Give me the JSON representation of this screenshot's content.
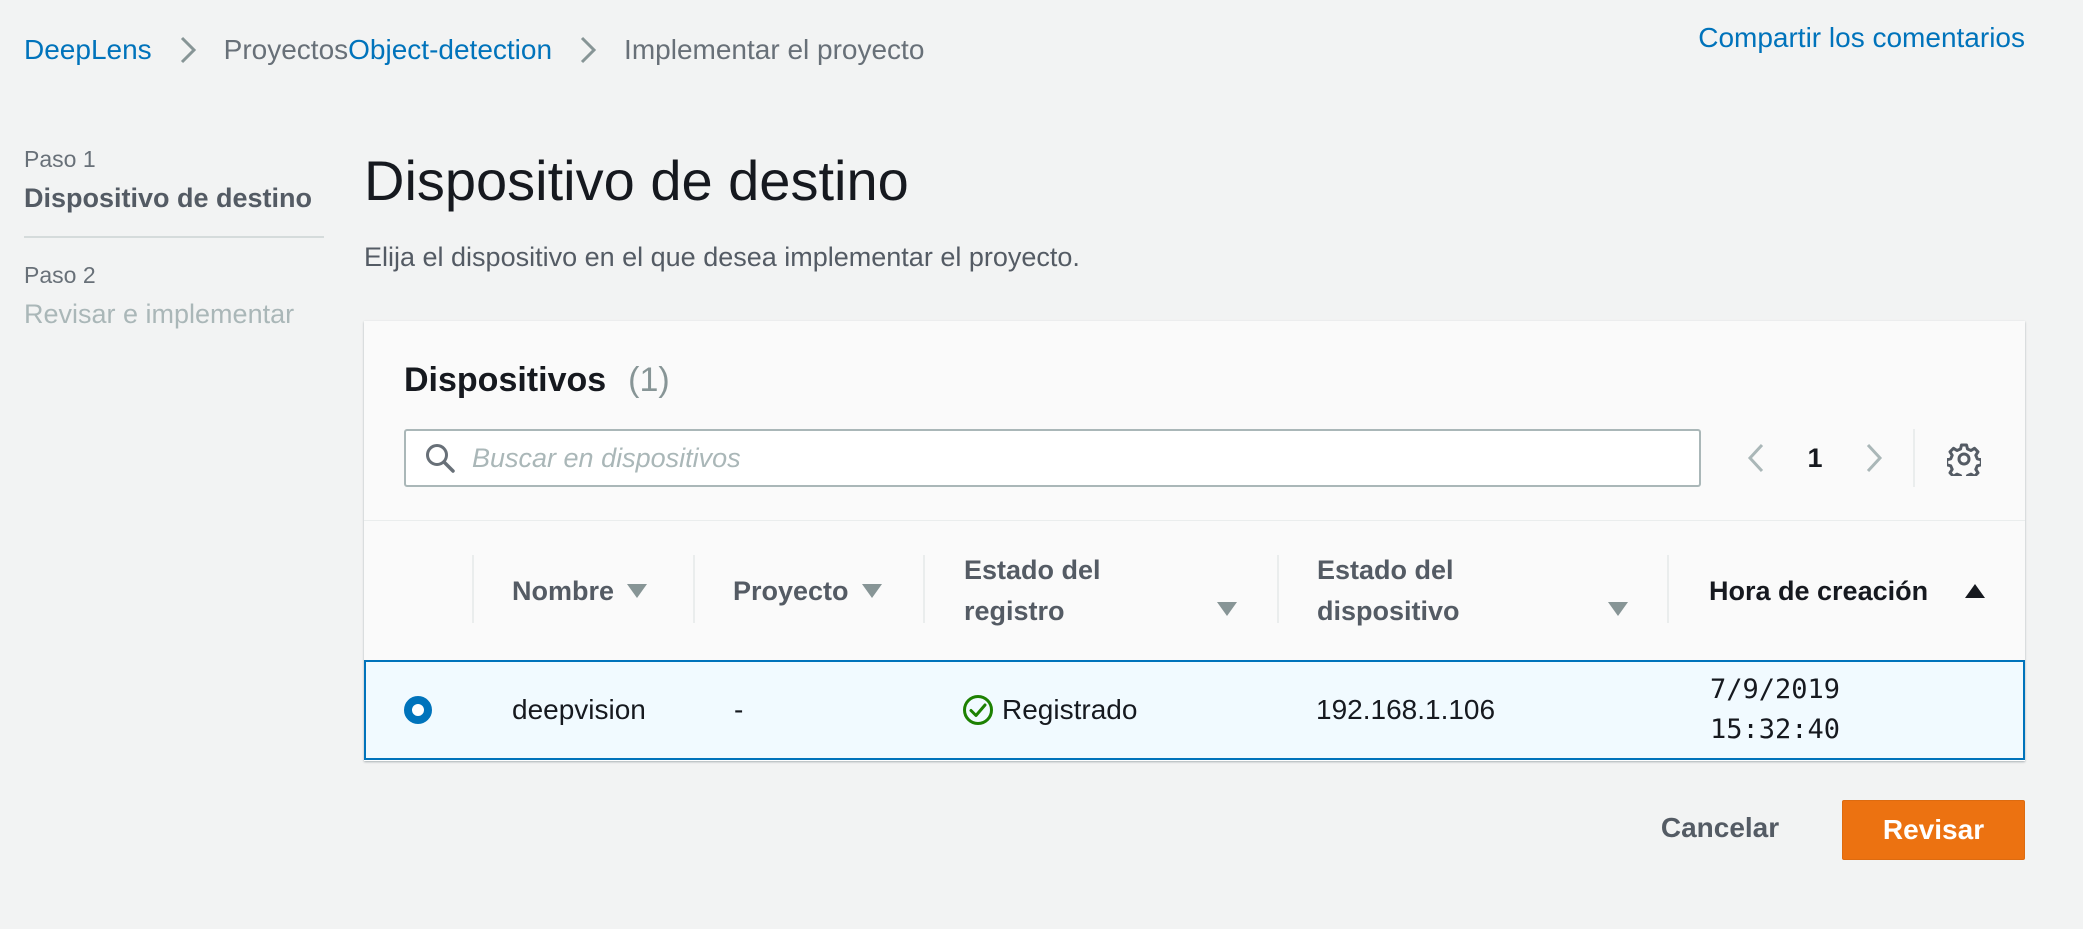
{
  "breadcrumb": {
    "items": [
      "DeepLens",
      "Proyectos",
      "Object-detection",
      "Implementar el proyecto"
    ]
  },
  "header": {
    "feedback_link": "Compartir los comentarios"
  },
  "steps": [
    {
      "number": "Paso 1",
      "title": "Dispositivo de destino",
      "active": true
    },
    {
      "number": "Paso 2",
      "title": "Revisar e implementar",
      "active": false
    }
  ],
  "main": {
    "title": "Dispositivo de destino",
    "description": "Elija el dispositivo en el que desea implementar el proyecto."
  },
  "devices_panel": {
    "title": "Dispositivos",
    "count": "(1)",
    "search": {
      "placeholder": "Buscar en dispositivos",
      "value": ""
    },
    "pagination": {
      "current_page": "1"
    },
    "columns": [
      {
        "label_line1": "Nombre",
        "label_line2": "",
        "sort": "caret-down"
      },
      {
        "label_line1": "Proyecto",
        "label_line2": "",
        "sort": "caret-down"
      },
      {
        "label_line1": "Estado del",
        "label_line2": "registro",
        "sort": "caret-down"
      },
      {
        "label_line1": "Estado del",
        "label_line2": "dispositivo",
        "sort": "caret-down"
      },
      {
        "label_line1": "Hora de creación",
        "label_line2": "",
        "sort": "caret-up"
      }
    ],
    "rows": [
      {
        "selected": true,
        "name": "deepvision",
        "project": "-",
        "registration_status": "Registrado",
        "device_status": "192.168.1.106",
        "created_date": "7/9/2019",
        "created_time": "15:32:40"
      }
    ]
  },
  "footer": {
    "cancel_label": "Cancelar",
    "primary_label": "Revisar"
  },
  "colors": {
    "link": "#0073bb",
    "primary_button": "#ec7211",
    "selected_row_bg": "#f1faff",
    "success": "#1d8102",
    "background": "#f2f3f3"
  },
  "icons": [
    "chevron-right-icon",
    "search-icon",
    "chevron-left-icon",
    "gear-icon",
    "caret-down-icon",
    "caret-up-icon",
    "check-circle-icon"
  ]
}
